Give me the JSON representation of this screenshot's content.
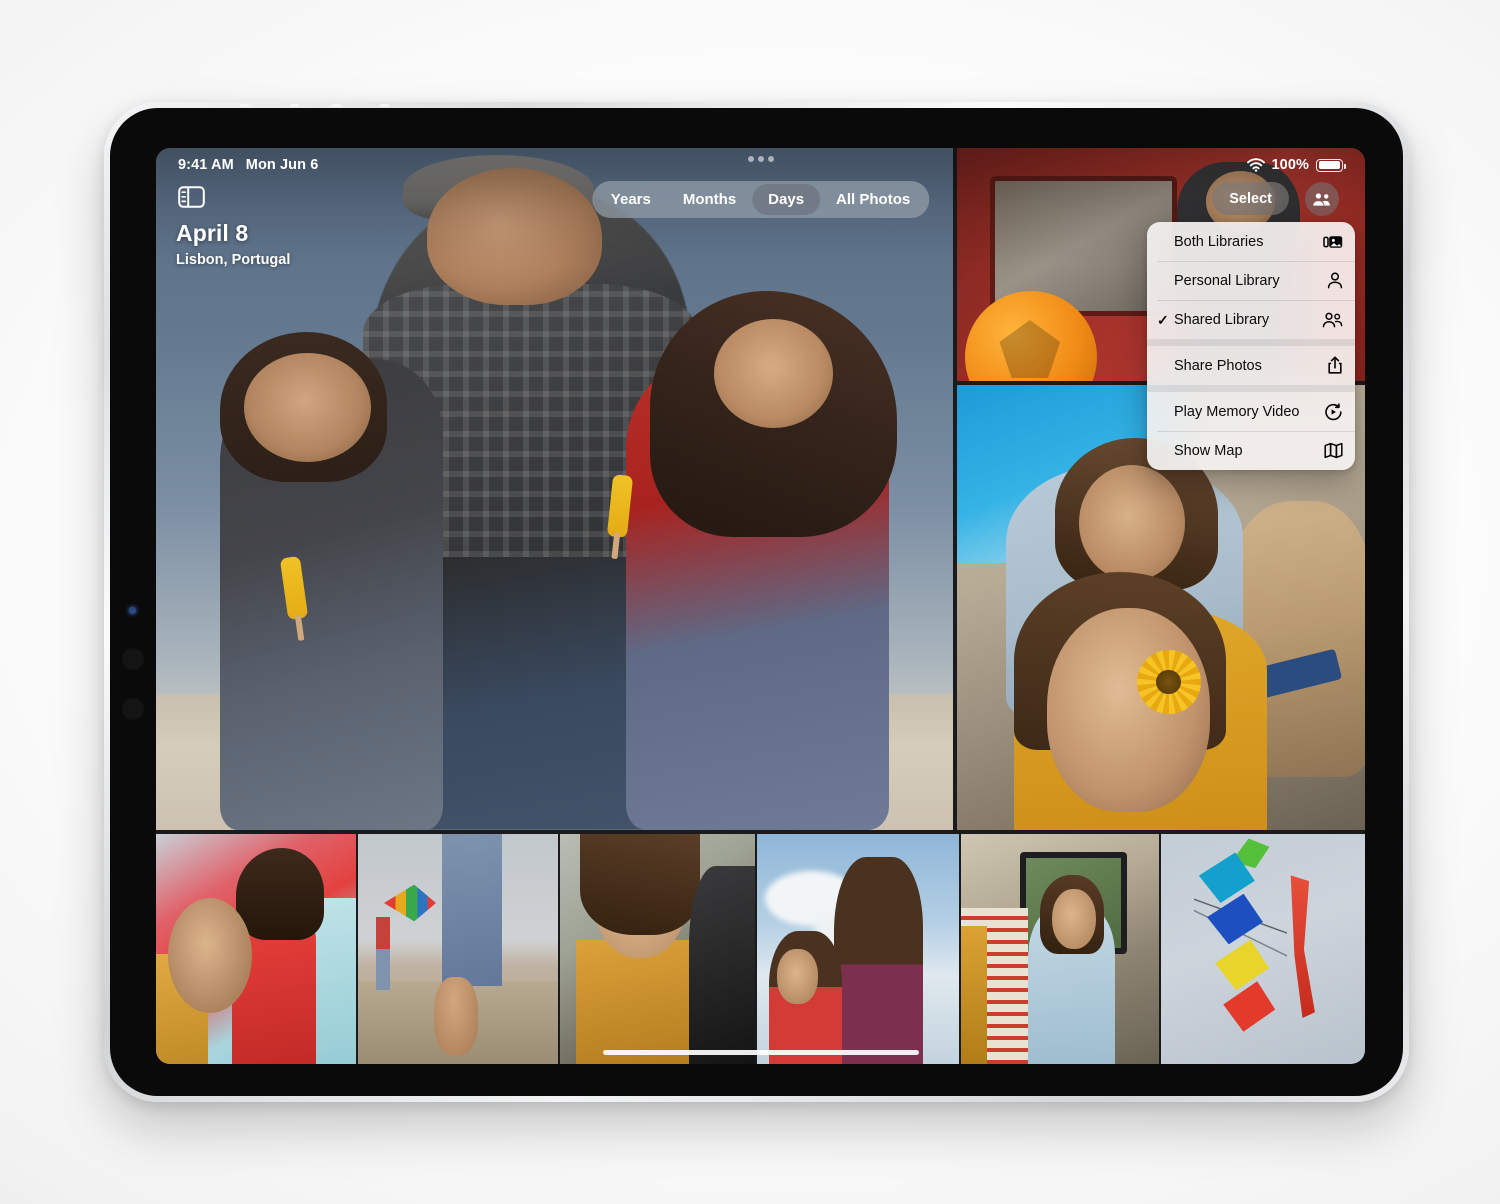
{
  "status_bar": {
    "time": "9:41 AM",
    "date": "Mon Jun 6",
    "battery_percent": "100%",
    "wifi_icon": "wifi-icon",
    "battery_icon": "battery-icon"
  },
  "header": {
    "sidebar_icon": "sidebar-toggle-icon",
    "multitask_handle_icon": "multitask-handle-icon",
    "day_title": "April 8",
    "location": "Lisbon, Portugal",
    "select_label": "Select",
    "people_icon": "shared-library-people-icon"
  },
  "segmented_control": {
    "options": [
      {
        "label": "Years",
        "active": false
      },
      {
        "label": "Months",
        "active": false
      },
      {
        "label": "Days",
        "active": true
      },
      {
        "label": "All Photos",
        "active": false
      }
    ],
    "selected": "Days"
  },
  "context_menu": {
    "groups": [
      {
        "items": [
          {
            "label": "Both Libraries",
            "checked": false,
            "icon": "both-libraries-icon"
          },
          {
            "label": "Personal Library",
            "checked": false,
            "icon": "person-icon"
          },
          {
            "label": "Shared Library",
            "checked": true,
            "icon": "two-people-icon"
          }
        ]
      },
      {
        "items": [
          {
            "label": "Share Photos",
            "checked": false,
            "icon": "share-icon"
          }
        ]
      },
      {
        "items": [
          {
            "label": "Play Memory Video",
            "checked": false,
            "icon": "play-memory-icon"
          },
          {
            "label": "Show Map",
            "checked": false,
            "icon": "map-icon"
          }
        ]
      }
    ],
    "checkmark_glyph": "✓"
  },
  "photo_grid": {
    "cells": [
      {
        "name": "hero-photo-family-beach",
        "alt": "Father and two girls with popsicles at the beach"
      },
      {
        "name": "photo-girl-van-ball",
        "alt": "Girl leaning on red van with orange football"
      },
      {
        "name": "photo-girls-flower-dog",
        "alt": "Two girls with sunflower and dog in car"
      },
      {
        "name": "thumb-girls-resting",
        "alt": "Two girls resting, red top and mint cardigan"
      },
      {
        "name": "thumb-kite-beach-feet",
        "alt": "Bare feet in sand with kite flyer"
      },
      {
        "name": "thumb-girl-car-window",
        "alt": "Girl resting on car door in yellow jacket"
      },
      {
        "name": "thumb-girls-sky",
        "alt": "Two girls against cloudy sky"
      },
      {
        "name": "thumb-girl-bus-window",
        "alt": "Girl in blue sweater looking out van window"
      },
      {
        "name": "thumb-kites-sky",
        "alt": "Colourful kites against grey sky"
      }
    ]
  },
  "home_indicator": {
    "name": "home-indicator"
  }
}
